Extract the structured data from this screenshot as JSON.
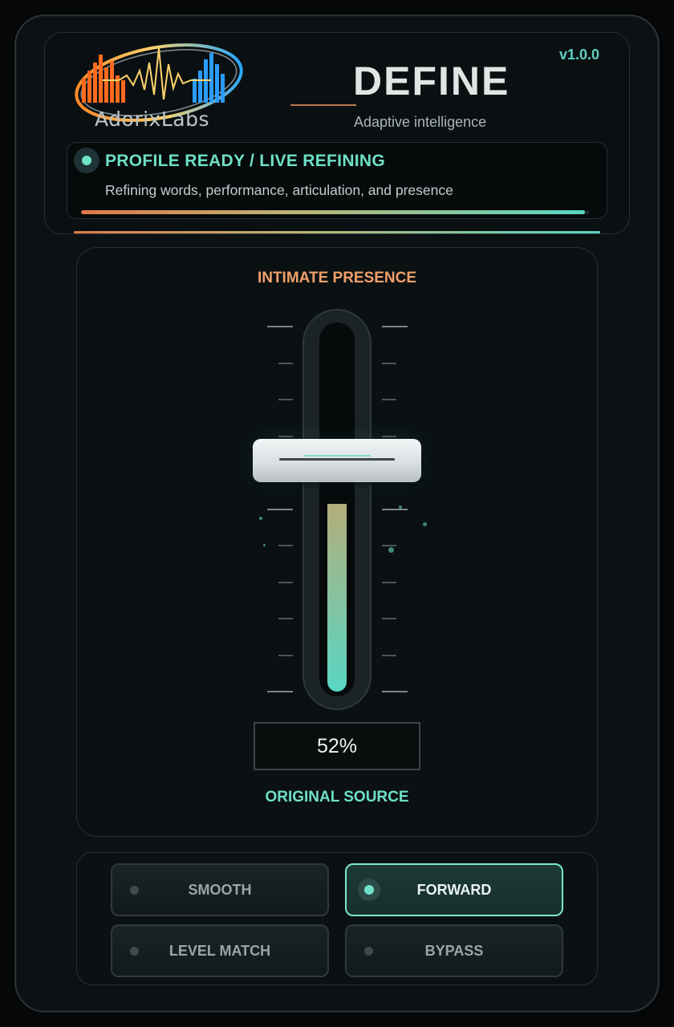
{
  "header": {
    "brand": "AdorixLabs",
    "version": "v1.0.0",
    "title": "DEFINE",
    "subtitle": "Adaptive intelligence"
  },
  "status": {
    "title": "PROFILE READY  /  LIVE REFINING",
    "description": "Refining words, performance, articulation, and presence",
    "progress_fraction": 0.99
  },
  "fader": {
    "top_label": "INTIMATE PRESENCE",
    "bottom_label": "ORIGINAL SOURCE",
    "value": 52,
    "value_text": "52%"
  },
  "modes": [
    {
      "label": "SMOOTH",
      "active": false
    },
    {
      "label": "FORWARD",
      "active": true
    },
    {
      "label": "LEVEL MATCH",
      "active": false
    },
    {
      "label": "BYPASS",
      "active": false
    }
  ],
  "colors": {
    "accent_teal": "#6ee0c8",
    "accent_orange": "#f0a06a"
  }
}
